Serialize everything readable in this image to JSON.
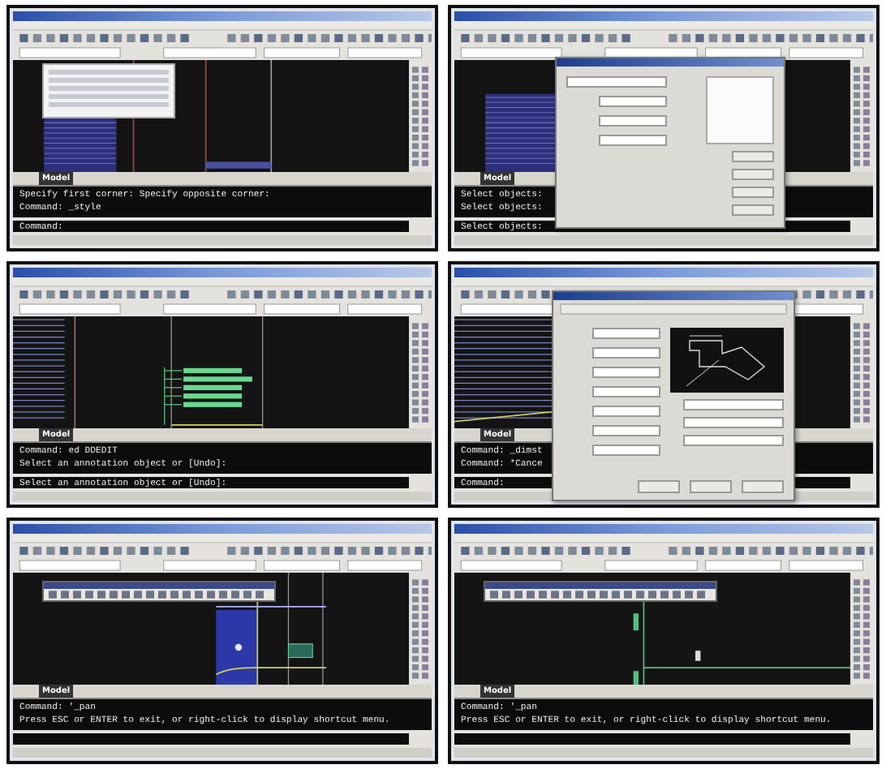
{
  "panels": [
    {
      "kind": "layers",
      "overlay": {
        "kind": "palette"
      },
      "model_tab": "Model",
      "command_lines": [
        "Specify first corner: Specify opposite corner:",
        "Command:  _style"
      ],
      "prompt": "Command:"
    },
    {
      "kind": "layers",
      "overlay": {
        "kind": "textstyle"
      },
      "model_tab": "Model",
      "command_lines": [
        "Select objects:",
        "Select objects:"
      ],
      "prompt": "Select objects:"
    },
    {
      "kind": "annotations",
      "model_tab": "Model",
      "command_lines": [
        "Command: ed DDEDIT",
        "Select an annotation object or [Undo]:"
      ],
      "prompt": "Select an annotation object or [Undo]:"
    },
    {
      "kind": "stripes",
      "overlay": {
        "kind": "dimstyle"
      },
      "model_tab": "Model",
      "command_lines": [
        "Command:  _dimst",
        "Command: *Cance"
      ],
      "prompt": "Command:"
    },
    {
      "kind": "building",
      "overlay": {
        "kind": "toolbar"
      },
      "model_tab": "Model",
      "command_lines": [
        "Command: '_pan",
        "Press ESC or ENTER to exit, or right-click to display shortcut menu."
      ]
    },
    {
      "kind": "dimension",
      "overlay": {
        "kind": "toolbar"
      },
      "model_tab": "Model",
      "command_lines": [
        "Command: '_pan",
        "Press ESC or ENTER to exit, or right-click to display shortcut menu."
      ]
    }
  ]
}
